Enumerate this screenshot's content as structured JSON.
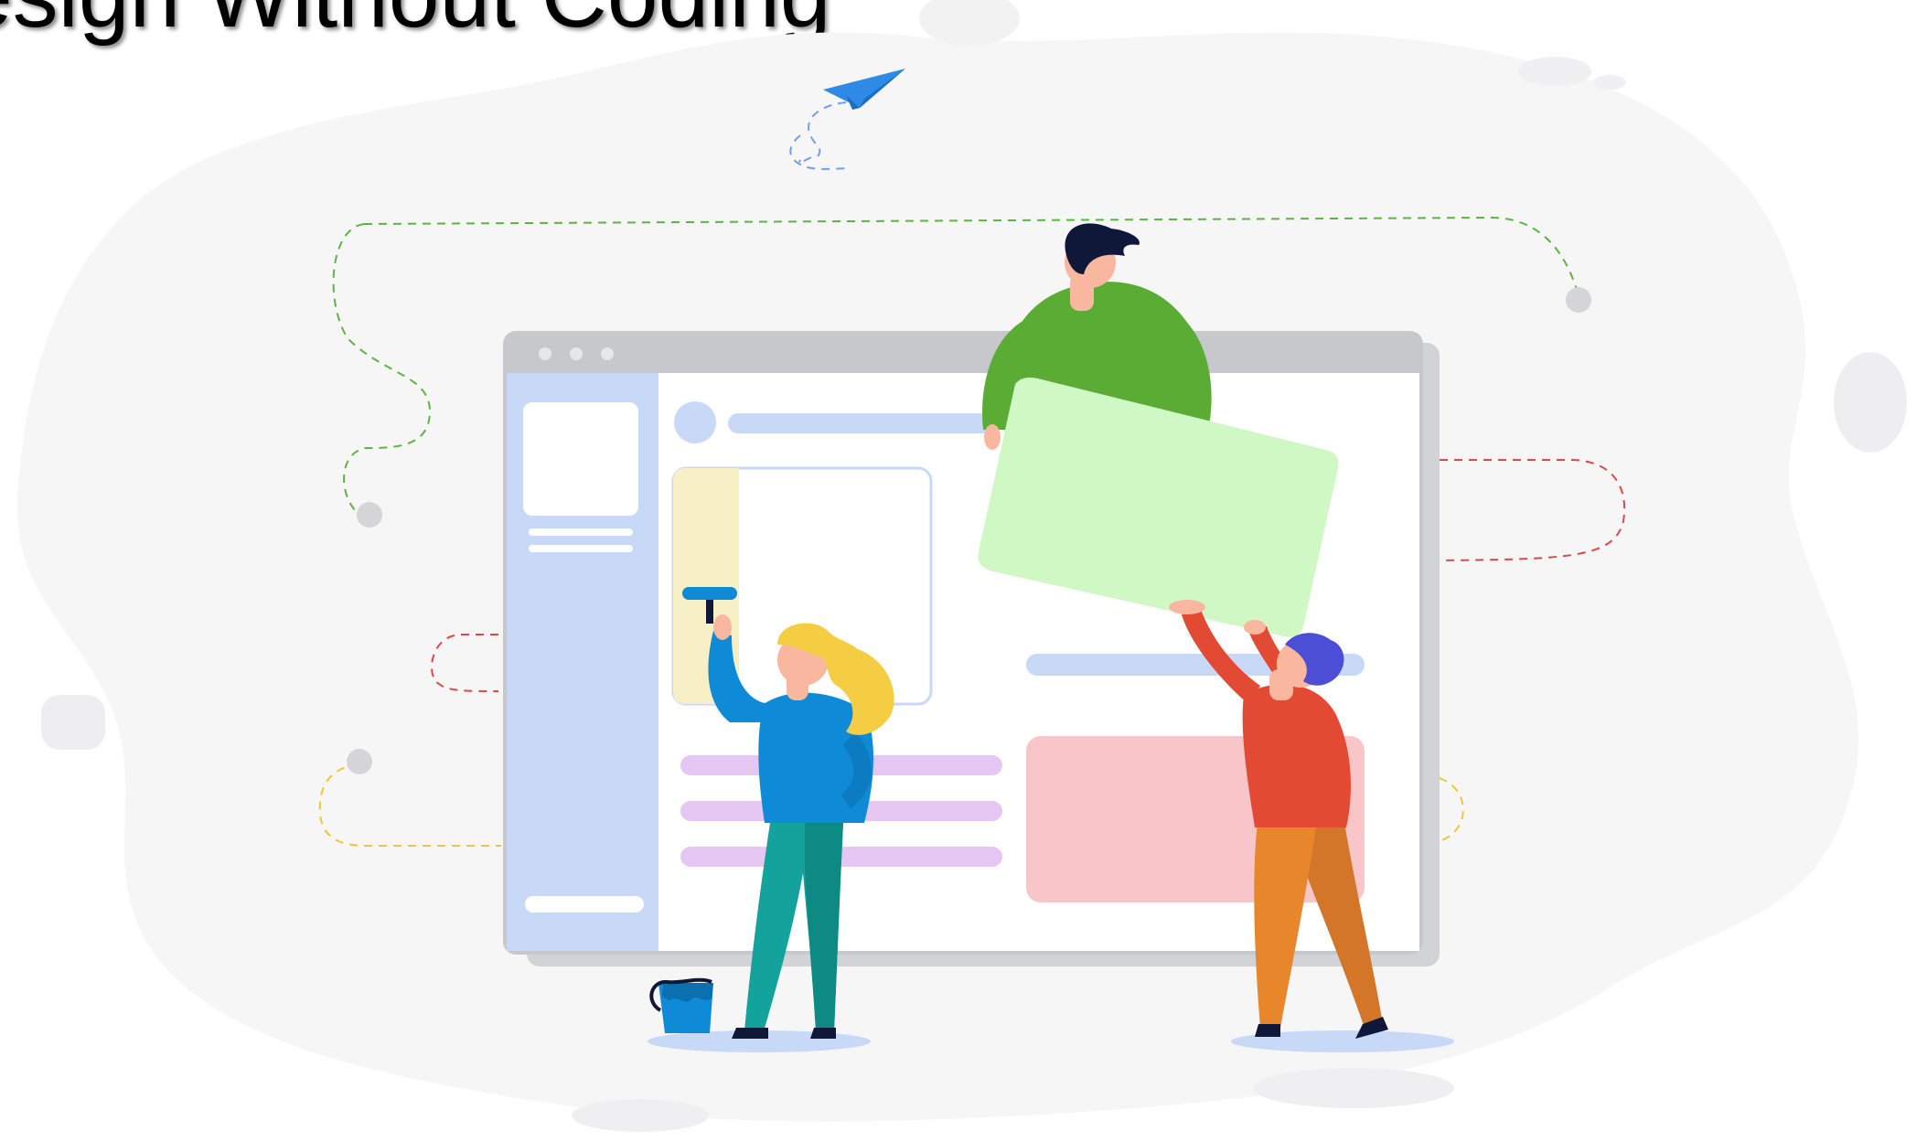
{
  "slide": {
    "title": "esign Without Coding"
  },
  "illustration": {
    "browser_dots": 3,
    "colors": {
      "blob": "#f6f6f7",
      "window_frame": "#c7c8cc",
      "sidebar": "#c8d9f7",
      "green_card": "#d0f8c4",
      "pink_card": "#f8c6c9",
      "purple_lines": "#e6c7f4",
      "yellow_panel": "#f7efc5",
      "man_shirt": "#5aac34",
      "woman_shirt": "#0f8ad6",
      "woman_hair": "#f5cd43",
      "man2_shirt": "#e34a33",
      "man2_pants": "#e7862a",
      "man2_hair": "#4c4fd6",
      "paper_plane": "#2f8ae6"
    },
    "icons": [
      "paper-plane-icon",
      "paint-bucket-icon",
      "paint-roller-icon"
    ]
  }
}
